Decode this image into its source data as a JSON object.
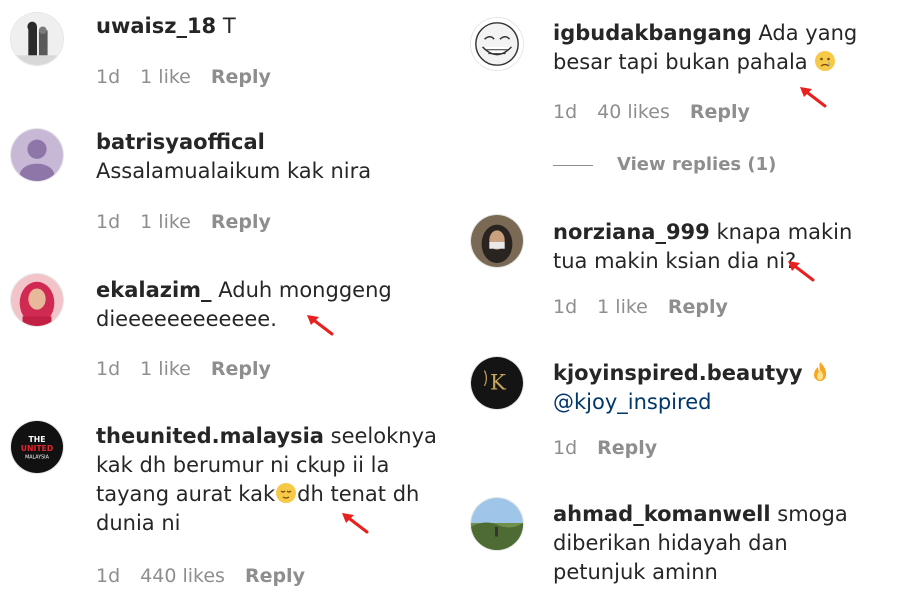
{
  "left": [
    {
      "username": "uwaisz_18",
      "text": "T",
      "time": "1d",
      "likes": "1 like",
      "reply": "Reply"
    },
    {
      "username": "batrisyaoffical",
      "text": "Assalamualaikum kak nira",
      "time": "1d",
      "likes": "1 like",
      "reply": "Reply"
    },
    {
      "username": "ekalazim_",
      "text": "Aduh monggeng dieeeeeeeeeeee.",
      "time": "1d",
      "likes": "1 like",
      "reply": "Reply"
    },
    {
      "username": "theunited.malaysia",
      "text": "seeloknya kak dh berumur ni ckup ii la tayang aurat kak",
      "text2": "dh tenat dh dunia ni",
      "time": "1d",
      "likes": "440 likes",
      "reply": "Reply",
      "avatar_text": "THE UNITED MALAYSIA"
    }
  ],
  "right": [
    {
      "username": "igbudakbangang",
      "text": "Ada yang besar tapi bukan pahala",
      "time": "1d",
      "likes": "40 likes",
      "reply": "Reply",
      "view_replies": "View replies (1)"
    },
    {
      "username": "norziana_999",
      "text": "knapa makin tua makin ksian dia ni?",
      "time": "1d",
      "likes": "1 like",
      "reply": "Reply"
    },
    {
      "username": "kjoyinspired.beautyy",
      "mention": "@kjoy_inspired",
      "time": "1d",
      "reply": "Reply",
      "avatar_letter": "K"
    },
    {
      "username": "ahmad_komanwell",
      "text": "smoga diberikan hidayah dan petunjuk aminn"
    }
  ],
  "colors": {
    "username": "#262626",
    "meta": "#8e8e8e",
    "mention": "#00376b",
    "arrow": "#e8201e"
  }
}
